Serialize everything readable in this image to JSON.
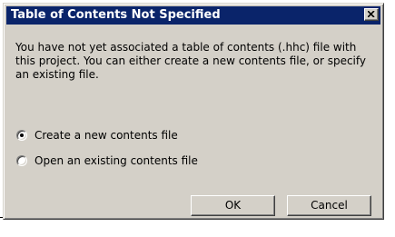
{
  "window": {
    "title": "Table of Contents Not Specified",
    "close_glyph": "×"
  },
  "message": "You have not yet associated a table of contents (.hhc) file with this project. You can either create a new contents file, or specify an existing file.",
  "options": [
    {
      "label": "Create a new contents file",
      "selected": true
    },
    {
      "label": "Open an existing contents file",
      "selected": false
    }
  ],
  "buttons": {
    "ok_label": "OK",
    "cancel_label": "Cancel"
  },
  "colors": {
    "titlebar": "#0a246a",
    "dialog_face": "#d4d0c8"
  }
}
